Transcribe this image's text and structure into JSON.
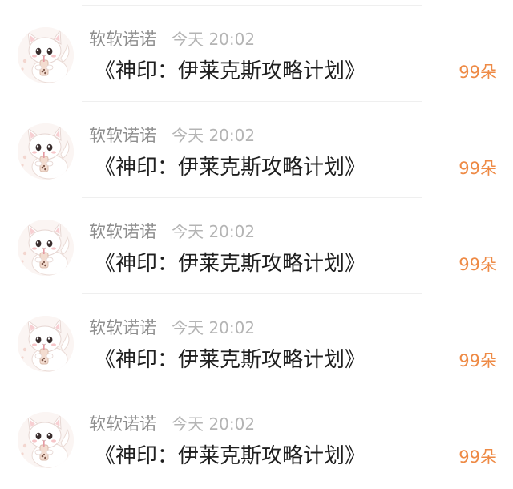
{
  "gift_records": [
    {
      "username": "软软诺诺",
      "time": "今天 20:02",
      "gift_name": "《神印：伊莱克斯攻略计划》",
      "count": "99朵",
      "avatar_icon": "white-cat-avatar"
    },
    {
      "username": "软软诺诺",
      "time": "今天 20:02",
      "gift_name": "《神印：伊莱克斯攻略计划》",
      "count": "99朵",
      "avatar_icon": "white-cat-avatar"
    },
    {
      "username": "软软诺诺",
      "time": "今天 20:02",
      "gift_name": "《神印：伊莱克斯攻略计划》",
      "count": "99朵",
      "avatar_icon": "white-cat-avatar"
    },
    {
      "username": "软软诺诺",
      "time": "今天 20:02",
      "gift_name": "《神印：伊莱克斯攻略计划》",
      "count": "99朵",
      "avatar_icon": "white-cat-avatar"
    },
    {
      "username": "软软诺诺",
      "time": "今天 20:02",
      "gift_name": "《神印：伊莱克斯攻略计划》",
      "count": "99朵",
      "avatar_icon": "white-cat-avatar"
    }
  ],
  "colors": {
    "username": "#8e8e8e",
    "time": "#b4b4b4",
    "gift_name": "#1f1f1f",
    "count_accent": "#ee8a45",
    "divider": "#efefef"
  }
}
